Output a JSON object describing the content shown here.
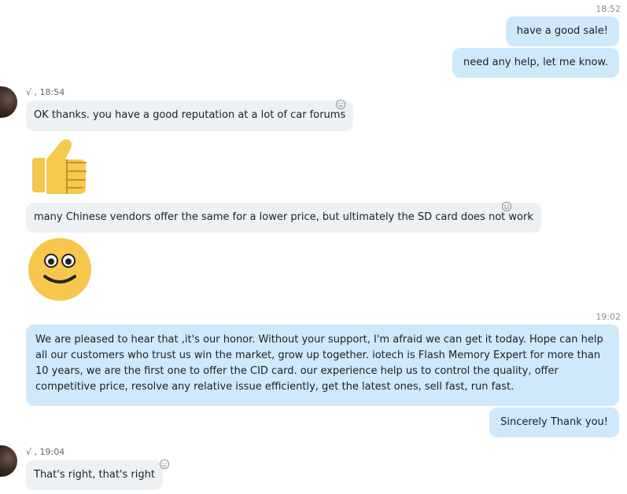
{
  "messages": {
    "m1": {
      "time": "18:52",
      "text": "have a good sale!"
    },
    "m2": {
      "text": "need any help, let me know."
    },
    "m3": {
      "meta": "√ , 18:54",
      "text": "OK thanks. you have a good reputation at a lot of car forums"
    },
    "m4": {
      "emoji": "thumbs-up"
    },
    "m5": {
      "text": "many Chinese vendors offer the same for a lower price, but ultimately the SD card does not work"
    },
    "m6": {
      "emoji": "smiling-face"
    },
    "m7": {
      "time": "19:02",
      "text": "We are pleased to hear that ,it's our honor.  Without your support, I'm afraid we can get it today. Hope can help all our customers who trust us win the market, grow up together. iotech is Flash Memory Expert for more than 10 years, we are the first one to offer the CID card. our experience help us to control the quality, offer competitive price, resolve any relative issue efficiently, get the latest ones, sell fast, run fast."
    },
    "m8": {
      "text": "Sincerely Thank you!"
    },
    "m9": {
      "meta": "√ , 19:04",
      "text": "That's right, that's right"
    }
  },
  "colors": {
    "outgoing_bubble": "#cfe9fb",
    "incoming_bubble": "#eef1f4",
    "timestamp": "#8a8f95"
  }
}
